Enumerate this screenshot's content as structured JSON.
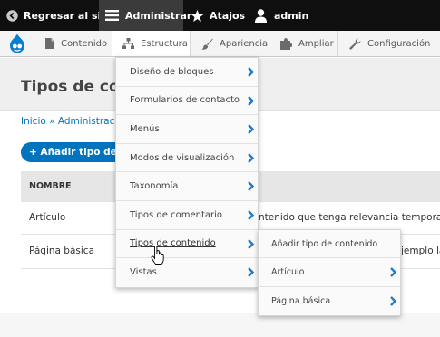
{
  "toolbar": {
    "back_label": "Regresar al sitio",
    "admin_menu_label": "Administrar",
    "shortcuts_label": "Atajos",
    "user_label": "admin"
  },
  "menubar": {
    "items": [
      {
        "label": "Contenido",
        "icon": "document-icon"
      },
      {
        "label": "Estructura",
        "icon": "structure-icon"
      },
      {
        "label": "Apariencia",
        "icon": "paintbrush-icon"
      },
      {
        "label": "Ampliar",
        "icon": "puzzle-icon"
      },
      {
        "label": "Configuración",
        "icon": "wrench-icon"
      }
    ]
  },
  "page": {
    "title": "Tipos de cont",
    "breadcrumb": "Inicio » Administració",
    "add_button": "+ Añadir tipo de co",
    "table_header_name": "NOMBRE",
    "rows": [
      {
        "name": "Artículo",
        "description": "ntenido que tenga relevancia temporal c"
      },
      {
        "name": "Página básica",
        "description": "jemplo la"
      }
    ]
  },
  "dropdown": {
    "items": [
      {
        "label": "Diseño de bloques"
      },
      {
        "label": "Formularios de contacto"
      },
      {
        "label": "Menús"
      },
      {
        "label": "Modos de visualización"
      },
      {
        "label": "Taxonomía"
      },
      {
        "label": "Tipos de comentario"
      },
      {
        "label": "Tipos de contenido"
      },
      {
        "label": "Vistas"
      }
    ],
    "submenu": [
      {
        "label": "Añadir tipo de contenido"
      },
      {
        "label": "Artículo"
      },
      {
        "label": "Página básica"
      }
    ]
  },
  "colors": {
    "toolbar_bg": "#0f0f0f",
    "accent_blue": "#0074bd",
    "chevron_blue": "#1f7ac9"
  }
}
